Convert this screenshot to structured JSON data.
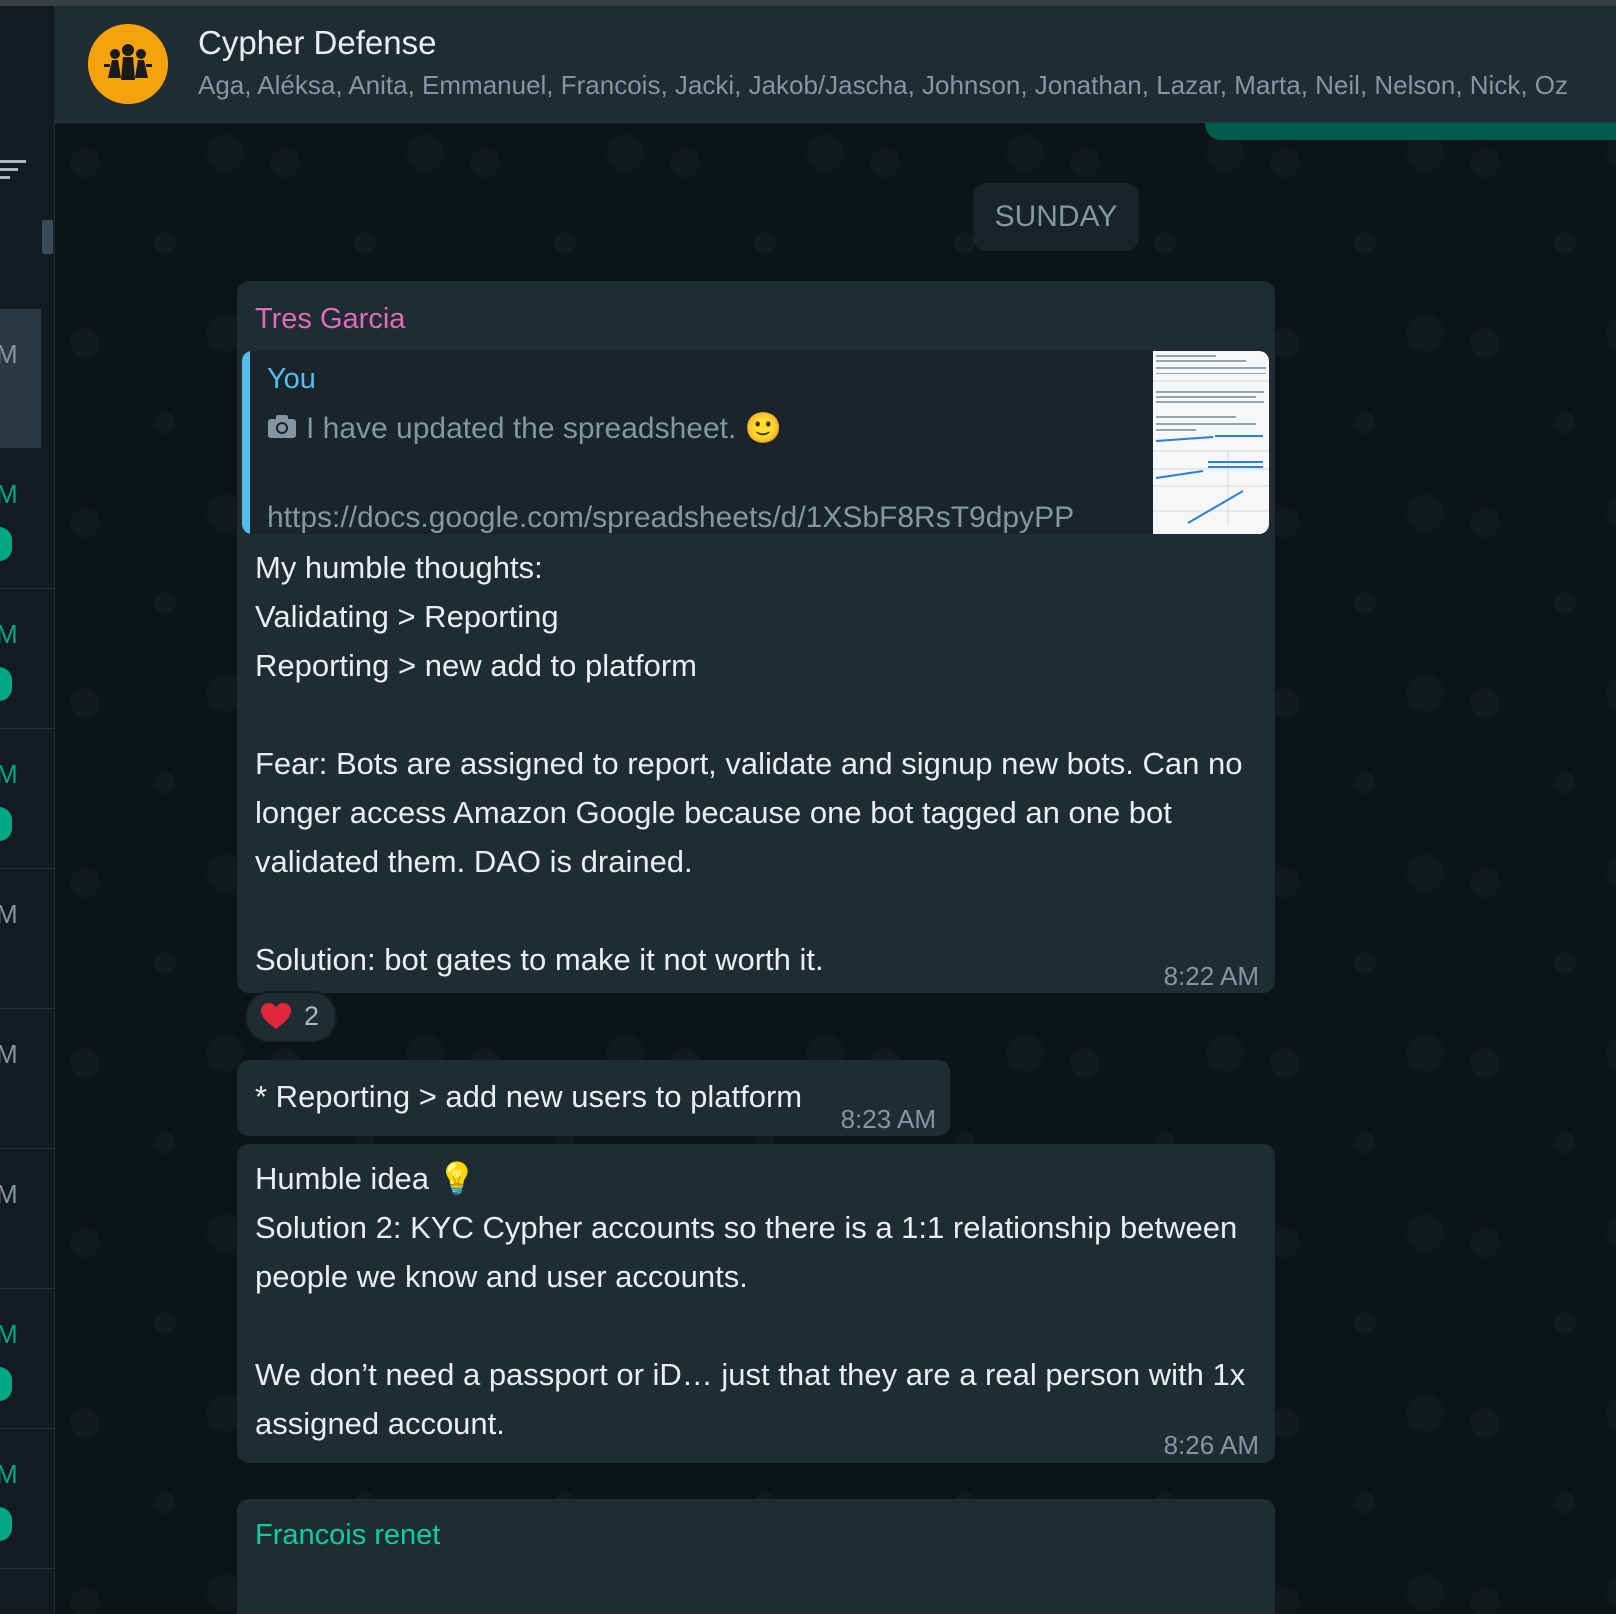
{
  "header": {
    "group_name": "Cypher Defense",
    "members": "Aga, Aléksa, Anita, Emmanuel, Francois, Jacki, Jakob/Jascha, Johnson, Jonathan, Lazar, Marta, Neil, Nelson, Nick, Oz"
  },
  "sidebar": {
    "rows": [
      {
        "time": "M",
        "green": false,
        "badge": false
      },
      {
        "time": "M",
        "green": true,
        "badge": true
      },
      {
        "time": "M",
        "green": true,
        "badge": true
      },
      {
        "time": "M",
        "green": true,
        "badge": true
      },
      {
        "time": "M",
        "green": false,
        "badge": false
      },
      {
        "time": "M",
        "green": false,
        "badge": false
      },
      {
        "time": "M",
        "green": false,
        "badge": false
      },
      {
        "time": "M",
        "green": true,
        "badge": true
      },
      {
        "time": "M",
        "green": true,
        "badge": true
      }
    ]
  },
  "chat": {
    "date_chip": "SUNDAY",
    "messages": [
      {
        "sender": "Tres Garcia",
        "quote": {
          "author": "You",
          "text": "I have updated the spreadsheet. 🙂",
          "link": "https://docs.google.com/spreadsheets/d/1XSbF8RsT9dpyPP"
        },
        "text": "My humble thoughts:\nValidating > Reporting\nReporting > new add to platform\n\nFear: Bots are assigned to report, validate and signup new bots. Can no longer access Amazon Google because one bot tagged an one bot validated them. DAO is drained.\n\nSolution: bot gates to make it not worth it.",
        "time": "8:22 AM",
        "reaction": {
          "emoji": "❤️",
          "count": "2"
        }
      },
      {
        "text": "* Reporting > add new users to platform",
        "time": "8:23 AM"
      },
      {
        "text": "Humble idea 💡\nSolution 2: KYC Cypher accounts so there is a 1:1 relationship between people we know and user accounts.\n\nWe don’t need a passport or iD… just that they are a real person with 1x assigned account.",
        "time": "8:26 AM"
      },
      {
        "sender": "Francois renet"
      }
    ]
  },
  "colors": {
    "sender_tres": "#e26ab6",
    "sender_francois": "#06cf9c",
    "quote_accent": "#53bdeb",
    "app_accent": "#00a884"
  },
  "icons": [
    "group-avatar-icon",
    "filter-icon",
    "camera-icon",
    "heart-reaction-icon"
  ]
}
